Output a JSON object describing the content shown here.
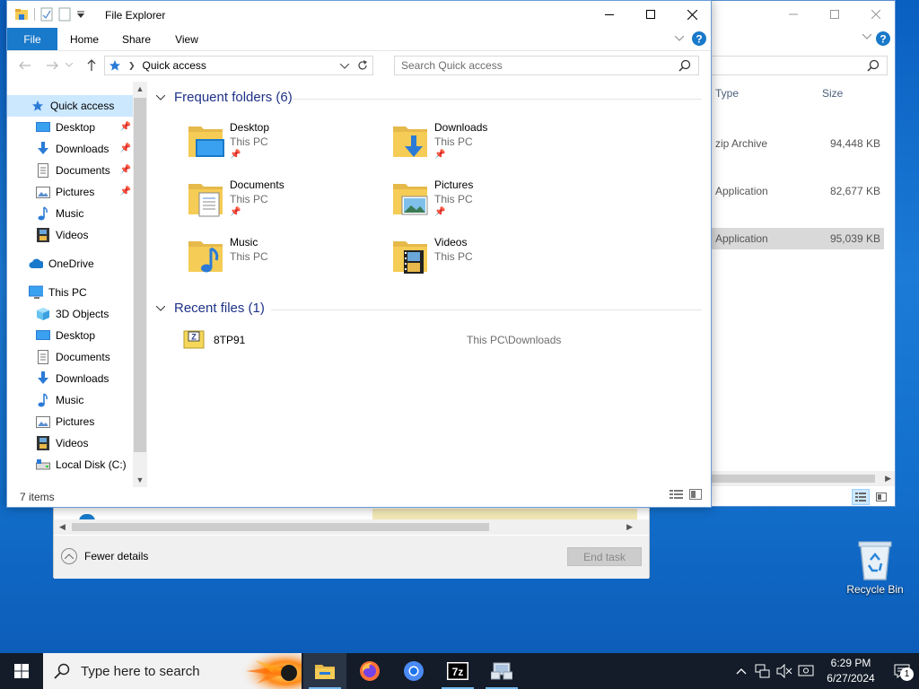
{
  "background_window": {
    "columns": [
      "Type",
      "Size"
    ],
    "rows": [
      {
        "type": "zip Archive",
        "size": "94,448 KB",
        "selected": false
      },
      {
        "type": "Application",
        "size": "82,677 KB",
        "selected": false
      },
      {
        "type": "Application",
        "size": "95,039 KB",
        "selected": true
      }
    ]
  },
  "task_manager": {
    "fewer_details": "Fewer details",
    "end_task": "End task"
  },
  "desktop": {
    "recycle_bin": "Recycle Bin"
  },
  "explorer": {
    "title": "File Explorer",
    "ribbon_tabs": [
      "File",
      "Home",
      "Share",
      "View"
    ],
    "address": "Quick access",
    "search_placeholder": "Search Quick access",
    "nav": [
      {
        "label": "Quick access",
        "icon": "star-icon",
        "pinned": false,
        "selected": true
      },
      {
        "label": "Desktop",
        "icon": "desktop-icon",
        "pinned": true
      },
      {
        "label": "Downloads",
        "icon": "download-icon",
        "pinned": true
      },
      {
        "label": "Documents",
        "icon": "document-icon",
        "pinned": true
      },
      {
        "label": "Pictures",
        "icon": "pictures-icon",
        "pinned": true
      },
      {
        "label": "Music",
        "icon": "music-icon",
        "pinned": false
      },
      {
        "label": "Videos",
        "icon": "videos-icon",
        "pinned": false
      },
      {
        "label": "OneDrive",
        "icon": "cloud-icon",
        "pinned": false
      },
      {
        "label": "This PC",
        "icon": "computer-icon",
        "pinned": false
      },
      {
        "label": "3D Objects",
        "icon": "cube-icon",
        "pinned": false
      },
      {
        "label": "Desktop",
        "icon": "desktop-icon",
        "pinned": false
      },
      {
        "label": "Documents",
        "icon": "document-icon",
        "pinned": false
      },
      {
        "label": "Downloads",
        "icon": "download-icon",
        "pinned": false
      },
      {
        "label": "Music",
        "icon": "music-icon",
        "pinned": false
      },
      {
        "label": "Pictures",
        "icon": "pictures-icon",
        "pinned": false
      },
      {
        "label": "Videos",
        "icon": "videos-icon",
        "pinned": false
      },
      {
        "label": "Local Disk (C:)",
        "icon": "drive-icon",
        "pinned": false
      }
    ],
    "frequent_header": "Frequent folders (6)",
    "frequent": [
      {
        "name": "Desktop",
        "location": "This PC",
        "pinned": true,
        "icon": "desktop-folder-icon"
      },
      {
        "name": "Downloads",
        "location": "This PC",
        "pinned": true,
        "icon": "downloads-folder-icon"
      },
      {
        "name": "Documents",
        "location": "This PC",
        "pinned": true,
        "icon": "documents-folder-icon"
      },
      {
        "name": "Pictures",
        "location": "This PC",
        "pinned": true,
        "icon": "pictures-folder-icon"
      },
      {
        "name": "Music",
        "location": "This PC",
        "pinned": false,
        "icon": "music-folder-icon"
      },
      {
        "name": "Videos",
        "location": "This PC",
        "pinned": false,
        "icon": "videos-folder-icon"
      }
    ],
    "recent_header": "Recent files (1)",
    "recent": [
      {
        "name": "8TP91",
        "path": "This PC\\Downloads",
        "icon": "zip-file-icon"
      }
    ],
    "status": "7 items"
  },
  "taskbar": {
    "search_placeholder": "Type here to search",
    "apps": [
      "file-explorer-icon",
      "firefox-icon",
      "chromium-icon",
      "7zip-icon",
      "network-app-icon"
    ],
    "time": "6:29 PM",
    "date": "6/27/2024",
    "notification_count": "1"
  },
  "colors": {
    "accent": "#1979ca",
    "selection": "#cce8ff",
    "group_header": "#1e3287",
    "folder_yellow": "#f5cc55"
  }
}
